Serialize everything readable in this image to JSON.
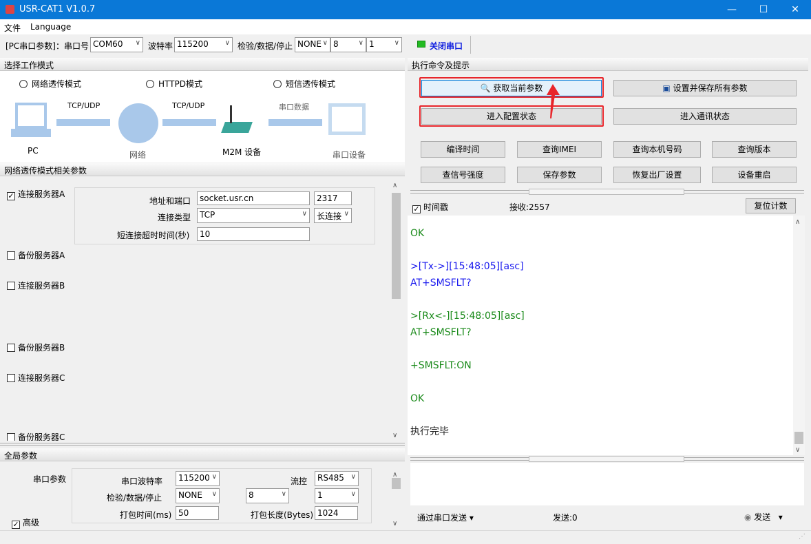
{
  "app": {
    "title": "USR-CAT1 V1.0.7"
  },
  "menu": [
    "文件",
    "Language"
  ],
  "toolbar": {
    "pc_label": "[PC串口参数]：串口号",
    "port": "COM60",
    "baud_label": "波特率",
    "baud": "115200",
    "parity_label": "检验/数据/停止",
    "parity": "NONE",
    "data_bits": "8",
    "stop_bits": "1",
    "close_port": "关闭串口",
    "status_color": "#22bb22"
  },
  "mode": {
    "header": "选择工作模式",
    "options": [
      "网络透传模式",
      "HTTPD模式",
      "短信透传模式"
    ],
    "diagram": {
      "link1": "TCP/UDP",
      "link2": "TCP/UDP",
      "link3": "串口数据",
      "pc": "PC",
      "net": "网络",
      "m2m": "M2M 设备",
      "serial": "串口设备"
    }
  },
  "net_params": {
    "header": "网络透传模式相关参数",
    "server_a": "连接服务器A",
    "addr_label": "地址和端口",
    "addr": "socket.usr.cn",
    "port": "2317",
    "type_label": "连接类型",
    "type": "TCP",
    "conn_mode": "长连接",
    "timeout_label": "短连接超时时间(秒)",
    "timeout": "10",
    "backup_a": "备份服务器A",
    "server_b": "连接服务器B",
    "backup_b": "备份服务器B",
    "server_c": "连接服务器C",
    "backup_c": "备份服务器C"
  },
  "global": {
    "header": "全局参数",
    "serial_label": "串口参数",
    "baud_label": "串口波特率",
    "baud": "115200",
    "flow_label": "流控",
    "flow": "RS485",
    "parity_label": "检验/数据/停止",
    "parity": "NONE",
    "data_bits": "8",
    "stop_bits": "1",
    "pack_time_label": "打包时间(ms)",
    "pack_time": "50",
    "pack_len_label": "打包长度(Bytes)",
    "pack_len": "1024",
    "advanced": "高级"
  },
  "commands": {
    "header": "执行命令及提示",
    "get_params": "获取当前参数",
    "save_all": "设置并保存所有参数",
    "enter_config": "进入配置状态",
    "enter_comm": "进入通讯状态",
    "buttons": [
      "编译时间",
      "查询IMEI",
      "查询本机号码",
      "查询版本",
      "查信号强度",
      "保存参数",
      "恢复出厂设置",
      "设备重启"
    ]
  },
  "log": {
    "timestamp": "时间戳",
    "recv": "接收:2557",
    "reset": "复位计数",
    "lines": [
      {
        "text": "OK",
        "color": "#1a8a1a"
      },
      {
        "text": "",
        "color": "#000"
      },
      {
        "text": ">[Tx->][15:48:05][asc]",
        "color": "#1a1aee"
      },
      {
        "text": "AT+SMSFLT?",
        "color": "#1a1aee"
      },
      {
        "text": "",
        "color": "#000"
      },
      {
        "text": ">[Rx<-][15:48:05][asc]",
        "color": "#1a8a1a"
      },
      {
        "text": "AT+SMSFLT?",
        "color": "#1a8a1a"
      },
      {
        "text": "",
        "color": "#000"
      },
      {
        "text": "+SMSFLT:ON",
        "color": "#1a8a1a"
      },
      {
        "text": "",
        "color": "#000"
      },
      {
        "text": "OK",
        "color": "#1a8a1a"
      },
      {
        "text": "",
        "color": "#000"
      },
      {
        "text": "执行完毕",
        "color": "#222"
      }
    ]
  },
  "send": {
    "via": "通过串口发送",
    "sent": "发送:0",
    "send": "发送"
  }
}
